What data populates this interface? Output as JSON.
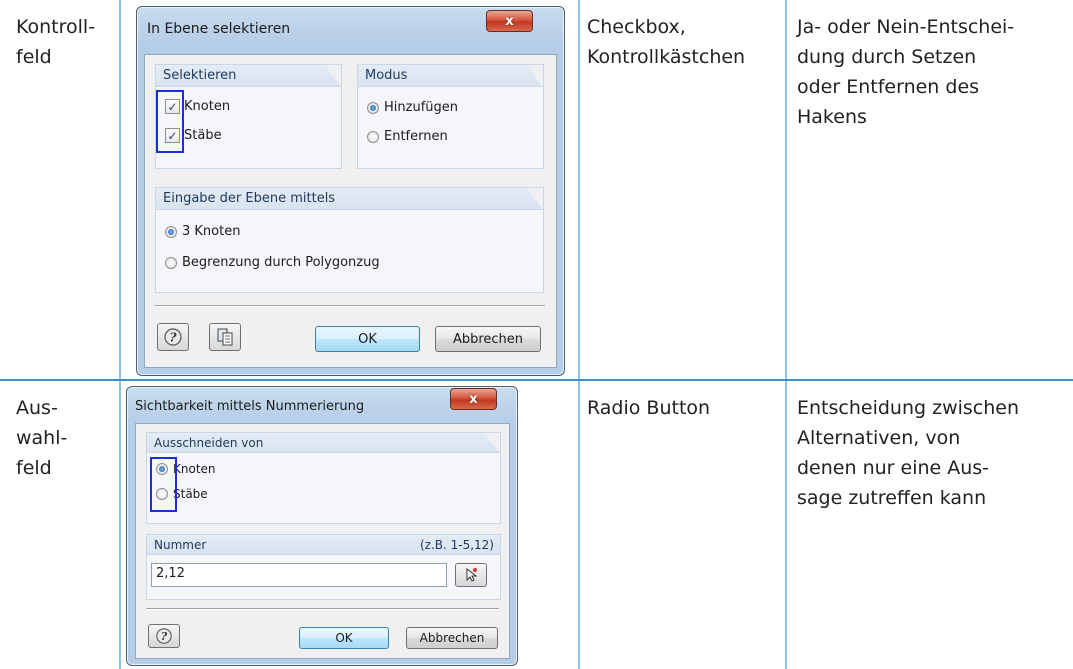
{
  "rows": [
    {
      "element": "Kontroll-\nfeld",
      "term": "Checkbox,\nKontrollkästchen",
      "description": "Ja- oder Nein-Entschei-\ndung durch Setzen\noder Entfernen des\nHakens"
    },
    {
      "element": "Aus-\nwahl-\nfeld",
      "term": "Radio Button",
      "description": "Entscheidung zwischen\nAlternativen, von\ndenen nur eine Aus-\nsage zutreffen kann"
    }
  ],
  "dialog1": {
    "title": "In Ebene selektieren",
    "close": "x",
    "group_select": {
      "label": "Selektieren",
      "options": [
        {
          "label": "Knoten",
          "checked": true
        },
        {
          "label": "Stäbe",
          "checked": true
        }
      ]
    },
    "group_mode": {
      "label": "Modus",
      "options": [
        {
          "label": "Hinzufügen",
          "selected": true
        },
        {
          "label": "Entfernen",
          "selected": false
        }
      ]
    },
    "group_plane": {
      "label": "Eingabe der Ebene mittels",
      "options": [
        {
          "label": "3 Knoten",
          "selected": true
        },
        {
          "label": "Begrenzung durch Polygonzug",
          "selected": false
        }
      ]
    },
    "buttons": {
      "ok": "OK",
      "cancel": "Abbrechen"
    },
    "icons": [
      "help-icon",
      "copy-icon"
    ]
  },
  "dialog2": {
    "title": "Sichtbarkeit mittels Nummerierung",
    "close": "x",
    "group_cut": {
      "label": "Ausschneiden von",
      "options": [
        {
          "label": "Knoten",
          "selected": true
        },
        {
          "label": "Stäbe",
          "selected": false
        }
      ]
    },
    "number": {
      "label": "Nummer",
      "hint": "(z.B. 1-5,12)",
      "value": "2,12"
    },
    "buttons": {
      "ok": "OK",
      "cancel": "Abbrechen"
    },
    "icons": [
      "help-icon",
      "pick-cursor-icon"
    ]
  },
  "colors": {
    "rule": "#3a8fc6",
    "column_line": "#8fc1e3",
    "highlight": "#1c2fd6"
  }
}
